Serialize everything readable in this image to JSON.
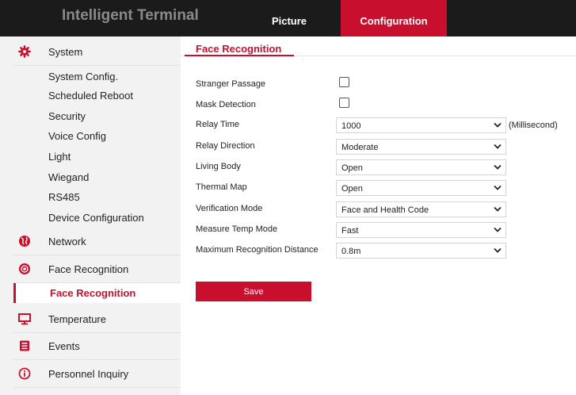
{
  "header": {
    "brand": "Intelligent Terminal",
    "tabs": [
      {
        "label": "Picture"
      },
      {
        "label": "Configuration"
      }
    ]
  },
  "sidebar": {
    "system": {
      "label": "System",
      "items": [
        "System Config.",
        "Scheduled Reboot",
        "Security",
        "Voice Config",
        "Light",
        "Wiegand",
        "RS485",
        "Device Configuration"
      ]
    },
    "network": {
      "label": "Network"
    },
    "face": {
      "label": "Face Recognition",
      "active_item": "Face Recognition"
    },
    "temperature": {
      "label": "Temperature"
    },
    "events": {
      "label": "Events"
    },
    "personnel": {
      "label": "Personnel Inquiry"
    }
  },
  "panel": {
    "title": "Face Recognition",
    "fields": [
      {
        "label": "Stranger Passage",
        "type": "checkbox",
        "checked": false
      },
      {
        "label": "Mask Detection",
        "type": "checkbox",
        "checked": false
      },
      {
        "label": "Relay Time",
        "type": "select",
        "value": "1000",
        "unit": "(Millisecond)"
      },
      {
        "label": "Relay Direction",
        "type": "select",
        "value": "Moderate"
      },
      {
        "label": "Living Body",
        "type": "select",
        "value": "Open"
      },
      {
        "label": "Thermal Map",
        "type": "select",
        "value": "Open"
      },
      {
        "label": "Verification Mode",
        "type": "select",
        "value": "Face and Health Code"
      },
      {
        "label": "Measure Temp Mode",
        "type": "select",
        "value": "Fast"
      },
      {
        "label": "Maximum Recognition Distance",
        "type": "select",
        "value": "0.8m"
      }
    ],
    "save_label": "Save"
  },
  "colors": {
    "accent": "#c8102e",
    "topbar": "#1b1b1b",
    "sidebar_bg": "#f2f2f2"
  }
}
